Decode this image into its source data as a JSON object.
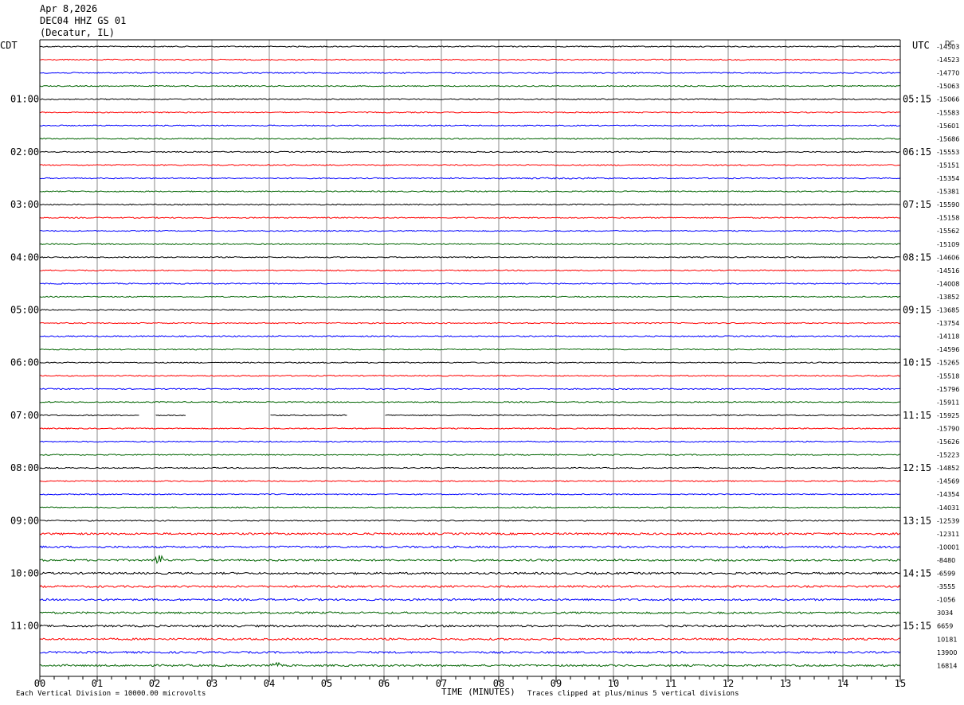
{
  "header": {
    "date": "Apr 8,2026",
    "station": "DEC04 HHZ GS 01",
    "location": "(Decatur, IL)"
  },
  "left_tz": "CDT",
  "right_tz": "UTC",
  "top_right_label": "DC",
  "footer": {
    "scale_note": "Each Vertical Division = 10000.00 microvolts",
    "xlabel": "TIME (MINUTES)",
    "clip_note": "Traces clipped at plus/minus 5 vertical divisions"
  },
  "chart_data": {
    "type": "line",
    "xlabel": "TIME (MINUTES)",
    "xlim": [
      0,
      15
    ],
    "x_ticks": [
      "00",
      "01",
      "02",
      "03",
      "04",
      "05",
      "06",
      "07",
      "08",
      "09",
      "10",
      "11",
      "12",
      "13",
      "14",
      "15"
    ],
    "trace_colors": [
      "#000000",
      "#ff0000",
      "#0000ff",
      "#006400"
    ],
    "left_hour_labels": [
      "01:00",
      "02:00",
      "03:00",
      "04:00",
      "05:00",
      "06:00",
      "07:00",
      "08:00",
      "09:00",
      "10:00",
      "11:00"
    ],
    "right_hour_labels": [
      "05:15",
      "06:15",
      "07:15",
      "08:15",
      "09:15",
      "10:15",
      "11:15",
      "12:15",
      "13:15",
      "14:15",
      "15:15"
    ],
    "trace_offsets": [
      "-14503",
      "-14523",
      "-14770",
      "-15063",
      "-15066",
      "-15583",
      "-15601",
      "-15686",
      "-15553",
      "-15151",
      "-15354",
      "-15381",
      "-15590",
      "-15158",
      "-15562",
      "-15109",
      "-14606",
      "-14516",
      "-14008",
      "-13852",
      "-13685",
      "-13754",
      "-14118",
      "-14596",
      "-15265",
      "-15518",
      "-15796",
      "-15911",
      "-15925",
      "-15790",
      "-15626",
      "-15223",
      "-14852",
      "-14569",
      "-14354",
      "-14031",
      "-12539",
      "-12311",
      "-10001",
      "-8480",
      "-6599",
      "-3555",
      "-1056",
      "3034",
      "6659",
      "10181",
      "13900",
      "16814"
    ],
    "gaps": [
      {
        "trace": 28,
        "from_min": 1.75,
        "to_min": 2.0
      },
      {
        "trace": 28,
        "from_min": 2.55,
        "to_min": 4.0
      },
      {
        "trace": 28,
        "from_min": 5.37,
        "to_min": 6.0
      }
    ],
    "events": [
      {
        "trace": 10,
        "from_min": 8.0,
        "to_min": 10.0,
        "amplitude": 1.4
      },
      {
        "trace": 39,
        "at_min": 2.1,
        "amplitude": 3.0
      },
      {
        "trace": 47,
        "at_min": 4.1,
        "amplitude": 1.5
      }
    ]
  }
}
